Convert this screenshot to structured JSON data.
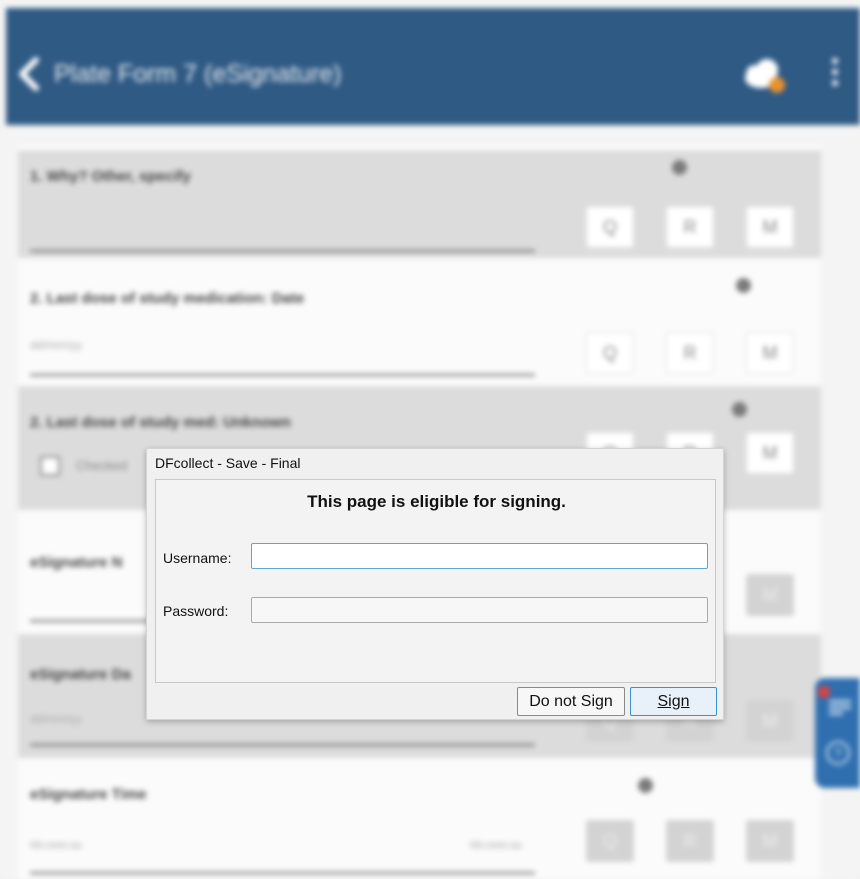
{
  "app": {
    "title": "Plate Form 7 (eSignature)",
    "icons": [
      "back-chevron-icon",
      "cloud-sync-icon",
      "more-vert-icon"
    ]
  },
  "form": {
    "q1": {
      "label": "1. Why? Other, specify"
    },
    "q2": {
      "label": "2. Last dose of study medication: Date",
      "hint": "dd/mm/yy"
    },
    "q3": {
      "label": "2. Last dose of study med: Unknown",
      "checkbox_label": "Checked"
    },
    "q4": {
      "label": "eSignature N"
    },
    "q5": {
      "label": "eSignature Da",
      "hint": "dd/mm/yy"
    },
    "q6": {
      "label": "eSignature Time",
      "hint": "hh:mm:ss",
      "unit": "hh:mm:ss"
    },
    "buttons": {
      "q": "Q",
      "r": "R",
      "m": "M"
    }
  },
  "dialog": {
    "title": "DFcollect - Save - Final",
    "message": "This page is eligible for signing.",
    "username_label": "Username:",
    "username_value": "",
    "password_label": "Password:",
    "password_value": "",
    "do_not_sign_label": "Do not Sign",
    "sign_label": "Sign"
  },
  "colors": {
    "app_bar": "#2f5a84",
    "focus_border": "#5aa6d6",
    "sign_border": "#3b8fd4",
    "badge": "#e0413a"
  }
}
